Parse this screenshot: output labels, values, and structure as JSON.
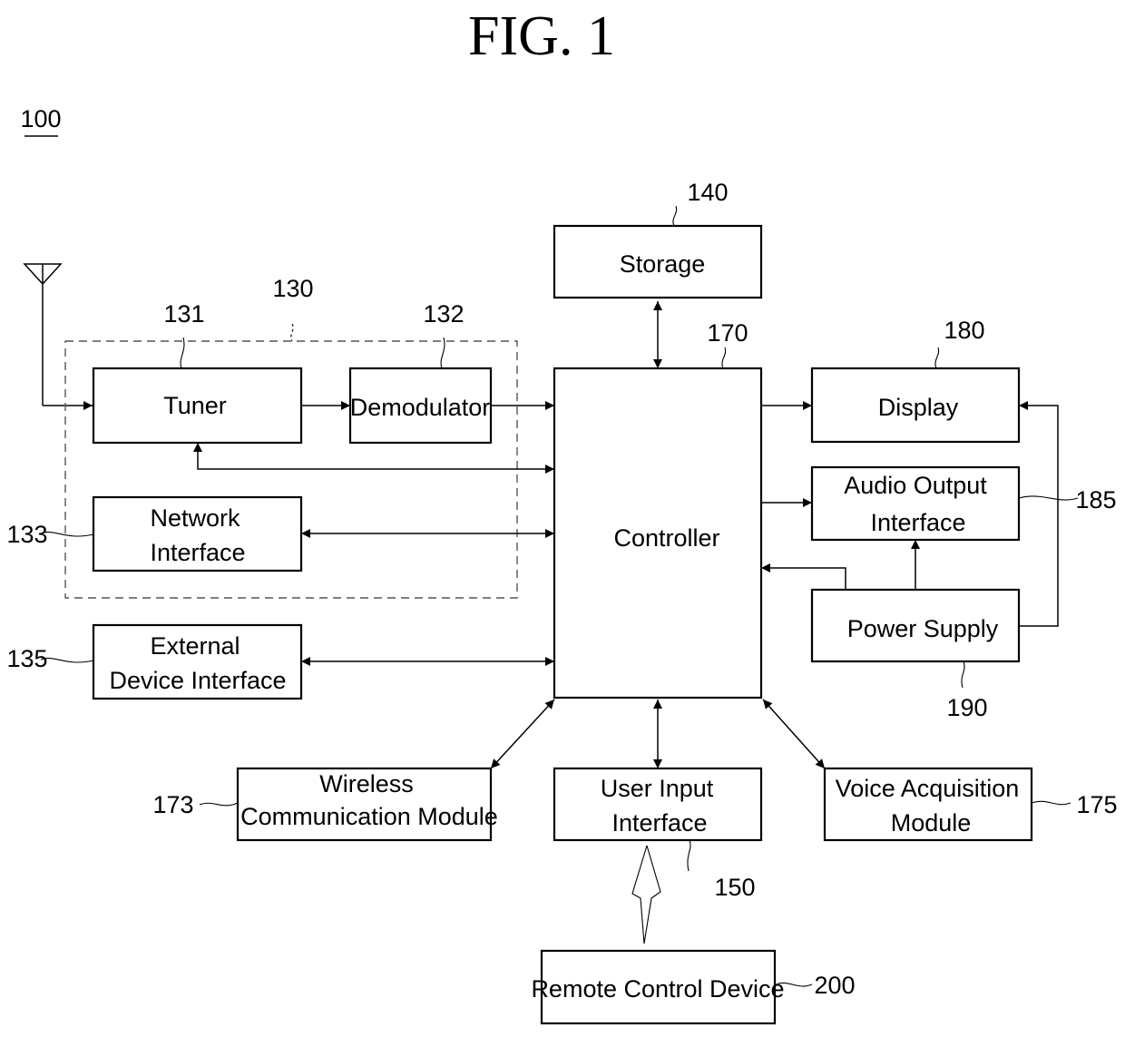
{
  "figure": {
    "title": "FIG. 1",
    "device_ref": "100"
  },
  "group": {
    "ref": "130"
  },
  "blocks": {
    "tuner": {
      "label": [
        "Tuner"
      ],
      "ref": "131"
    },
    "demodulator": {
      "label": [
        "Demodulator"
      ],
      "ref": "132"
    },
    "network_interface": {
      "label": [
        "Network",
        "Interface"
      ],
      "ref": "133"
    },
    "external_device_interface": {
      "label": [
        "External",
        "Device Interface"
      ],
      "ref": "135"
    },
    "storage": {
      "label": [
        "Storage"
      ],
      "ref": "140"
    },
    "controller": {
      "label": [
        "Controller"
      ],
      "ref": "170"
    },
    "display": {
      "label": [
        "Display"
      ],
      "ref": "180"
    },
    "audio_output_interface": {
      "label": [
        "Audio Output",
        "Interface"
      ],
      "ref": "185"
    },
    "power_supply": {
      "label": [
        "Power Supply"
      ],
      "ref": "190"
    },
    "wireless_communication_module": {
      "label": [
        "Wireless",
        "Communication Module"
      ],
      "ref": "173"
    },
    "user_input_interface": {
      "label": [
        "User Input",
        "Interface"
      ],
      "ref": "150"
    },
    "voice_acquisition_module": {
      "label": [
        "Voice Acquisition",
        "Module"
      ],
      "ref": "175"
    },
    "remote_control_device": {
      "label": [
        "Remote Control Device"
      ],
      "ref": "200"
    }
  }
}
